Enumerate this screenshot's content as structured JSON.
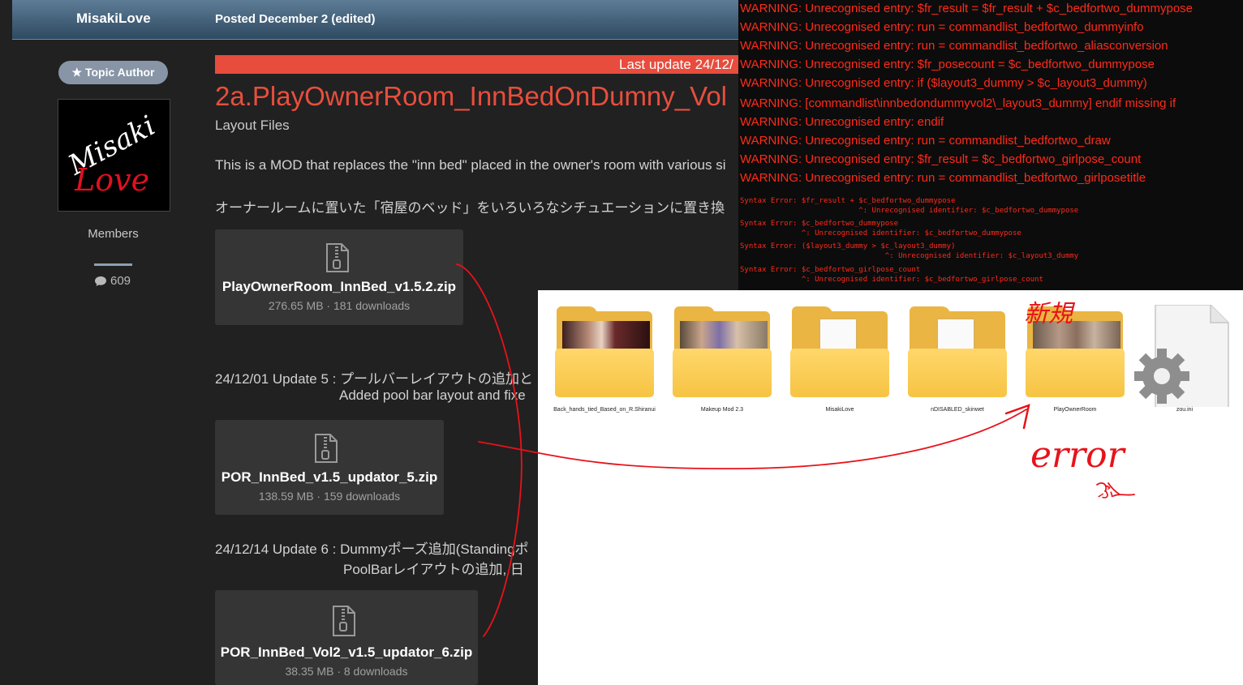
{
  "forum": {
    "author_name": "MisakiLove",
    "post_date": "Posted December 2 (edited)",
    "topic_author_badge": "Topic Author",
    "avatar_text_line1": "Misaki",
    "avatar_text_line2": "Love",
    "member_group": "Members",
    "post_count": "609",
    "banner_text": "Last update 24/12/",
    "title": "2a.PlayOwnerRoom_InnBedOnDumny_Vol",
    "subtitle": "Layout Files",
    "desc_en": "This is a MOD that replaces the \"inn bed\" placed in the owner's room with various si",
    "desc_jp": "オーナールームに置いた「宿屋のベッド」をいろいろなシチュエーションに置き換",
    "files": [
      {
        "name": "PlayOwnerRoom_InnBed_v1.5.2.zip",
        "meta": "276.65 MB · 181 downloads"
      },
      {
        "name": "POR_InnBed_v1.5_updator_5.zip",
        "meta": "138.59 MB · 159 downloads"
      },
      {
        "name": "POR_InnBed_Vol2_v1.5_updator_6.zip",
        "meta": "38.35 MB · 8 downloads"
      }
    ],
    "update5_line1": "24/12/01 Update 5 : プールバーレイアウトの追加と",
    "update5_line2": "Added pool bar layout and fixe",
    "update6_line1": "24/12/14 Update 6 : Dummyポーズ追加(Standingポ",
    "update6_line2": "PoolBarレイアウトの追加,  日"
  },
  "console": {
    "warnings": [
      "WARNING: Unrecognised entry: $fr_result = $fr_result + $c_bedfortwo_dummypose",
      "WARNING: Unrecognised entry: run = commandlist_bedfortwo_dummyinfo",
      "WARNING: Unrecognised entry: run = commandlist_bedfortwo_aliasconversion",
      "WARNING: Unrecognised entry: $fr_posecount = $c_bedfortwo_dummypose",
      "WARNING: Unrecognised entry: if ($layout3_dummy > $c_layout3_dummy)",
      "WARNING: [commandlist\\innbedondummyvol2\\_layout3_dummy] endif missing if",
      "WARNING: Unrecognised entry: endif",
      "WARNING: Unrecognised entry: run = commandlist_bedfortwo_draw",
      "WARNING: Unrecognised entry: $fr_result = $c_bedfortwo_girlpose_count",
      "WARNING: Unrecognised entry: run = commandlist_bedfortwo_girlposetitle"
    ],
    "syntax_errors": [
      {
        "line": "Syntax Error: $fr_result + $c_bedfortwo_dummypose",
        "detail": "                           ^: Unrecognised identifier: $c_bedfortwo_dummypose"
      },
      {
        "line": "Syntax Error: $c_bedfortwo_dummypose",
        "detail": "              ^: Unrecognised identifier: $c_bedfortwo_dummypose"
      },
      {
        "line": "Syntax Error: ($layout3_dummy > $c_layout3_dummy)",
        "detail": "                                 ^: Unrecognised identifier: $c_layout3_dummy"
      },
      {
        "line": "Syntax Error: $c_bedfortwo_girlpose_count",
        "detail": "              ^: Unrecognised identifier: $c_bedfortwo_girlpose_count"
      }
    ]
  },
  "explorer": {
    "items": [
      {
        "label": "Back_hands_tied_Based_on_R.Shiranui",
        "icon": "folder-with-image-icon"
      },
      {
        "label": "Makeup Mod 2.3",
        "icon": "folder-with-image-icon"
      },
      {
        "label": "MisakiLove",
        "icon": "folder-icon"
      },
      {
        "label": "nDISABLED_skinwet",
        "icon": "folder-icon"
      },
      {
        "label": "PlayOwnerRoom",
        "icon": "folder-with-image-icon"
      },
      {
        "label": "zou.ini",
        "icon": "settings-file-icon"
      }
    ]
  },
  "annotations": {
    "new_label": "新規",
    "error_label": "error",
    "error_suffix": "ふ",
    "color": "#e8121a"
  },
  "colors": {
    "header_gradient_top": "#5d7c96",
    "title_red": "#e84e3d",
    "banner_red": "#e74c3c",
    "console_text": "#ff2a1a",
    "folder_yellow": "#f6c443"
  }
}
